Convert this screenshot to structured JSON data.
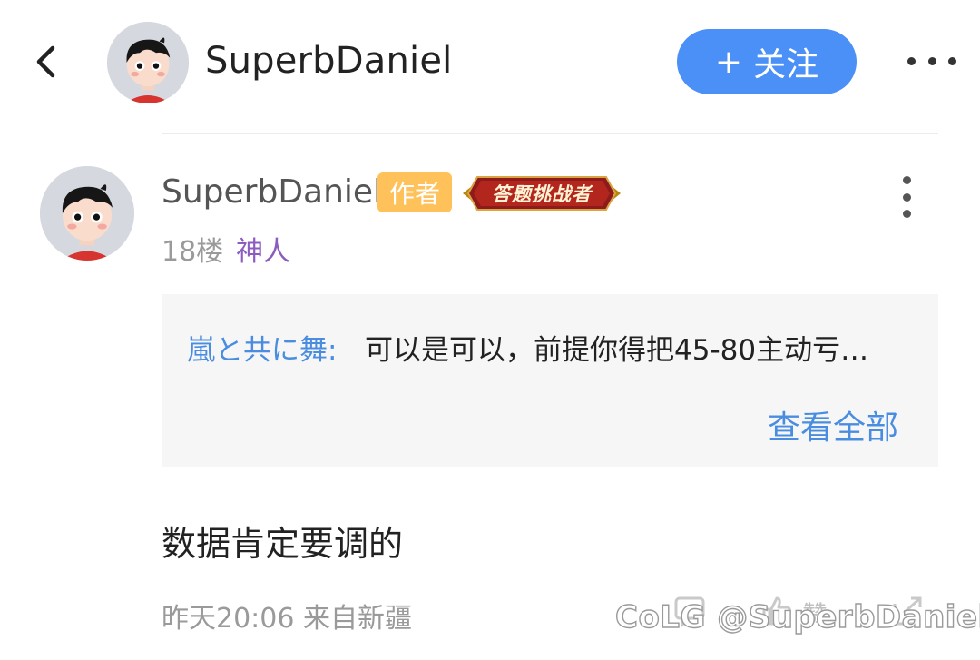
{
  "header": {
    "username": "SuperbDaniel",
    "follow_plus": "+",
    "follow_label": "关注"
  },
  "comment": {
    "username": "SuperbDaniel",
    "author_badge": "作者",
    "challenge_badge": "答题挑战者",
    "floor": "18楼",
    "rank": "神人",
    "quote": {
      "author": "嵐と共に舞:",
      "text": "可以是可以，前提你得把45-80主动亏…",
      "view_all": "查看全部"
    },
    "content": "数据肯定要调的",
    "meta": "昨天20:06 来自新疆",
    "like_label": "赞"
  },
  "watermark": "CoLG @SuperbDaniel",
  "colors": {
    "accent": "#4a90f7",
    "link": "#4a8de0",
    "author_badge_bg": "#ffc25a",
    "rank": "#8b5bbf",
    "quote_bg": "#f6f6f6"
  },
  "icons": [
    "back-arrow-icon",
    "more-horizontal-icon",
    "more-vertical-icon",
    "reply-icon",
    "like-icon",
    "share-icon"
  ]
}
